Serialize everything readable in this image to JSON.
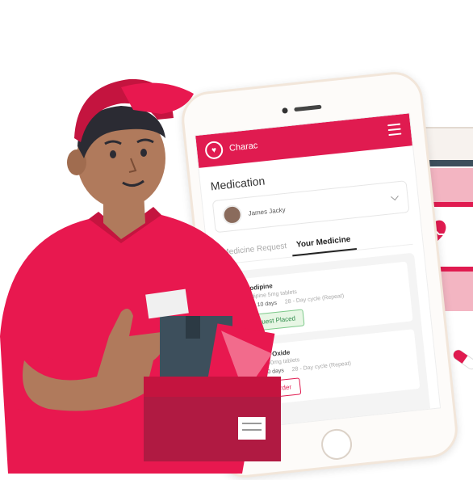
{
  "colors": {
    "brand": "#e01b50",
    "success": "#2e8b4a",
    "success_bg": "#e7f6e4"
  },
  "app": {
    "name": "Charac",
    "logo_icon": "heart-circle-icon",
    "menu_icon": "hamburger-menu-icon"
  },
  "page": {
    "title": "Medication"
  },
  "patient": {
    "name": "James Jacky"
  },
  "tabs": [
    {
      "label": "Medicine Request",
      "active": false
    },
    {
      "label": "Your Medicine",
      "active": true
    }
  ],
  "medicines": [
    {
      "name": "Amlodipine",
      "description": "Amlodipine 5mg tablets",
      "due": "Due in 10 days",
      "cycle": "28 - Day cycle (Repeat)",
      "action": "Request Placed"
    },
    {
      "name": "Atenolol Oxide",
      "description": "Atenolol 50mg tablets",
      "due": "Due in 10 days",
      "cycle": "28 - Day cycle (Repeat)",
      "action": "Place Order"
    }
  ]
}
